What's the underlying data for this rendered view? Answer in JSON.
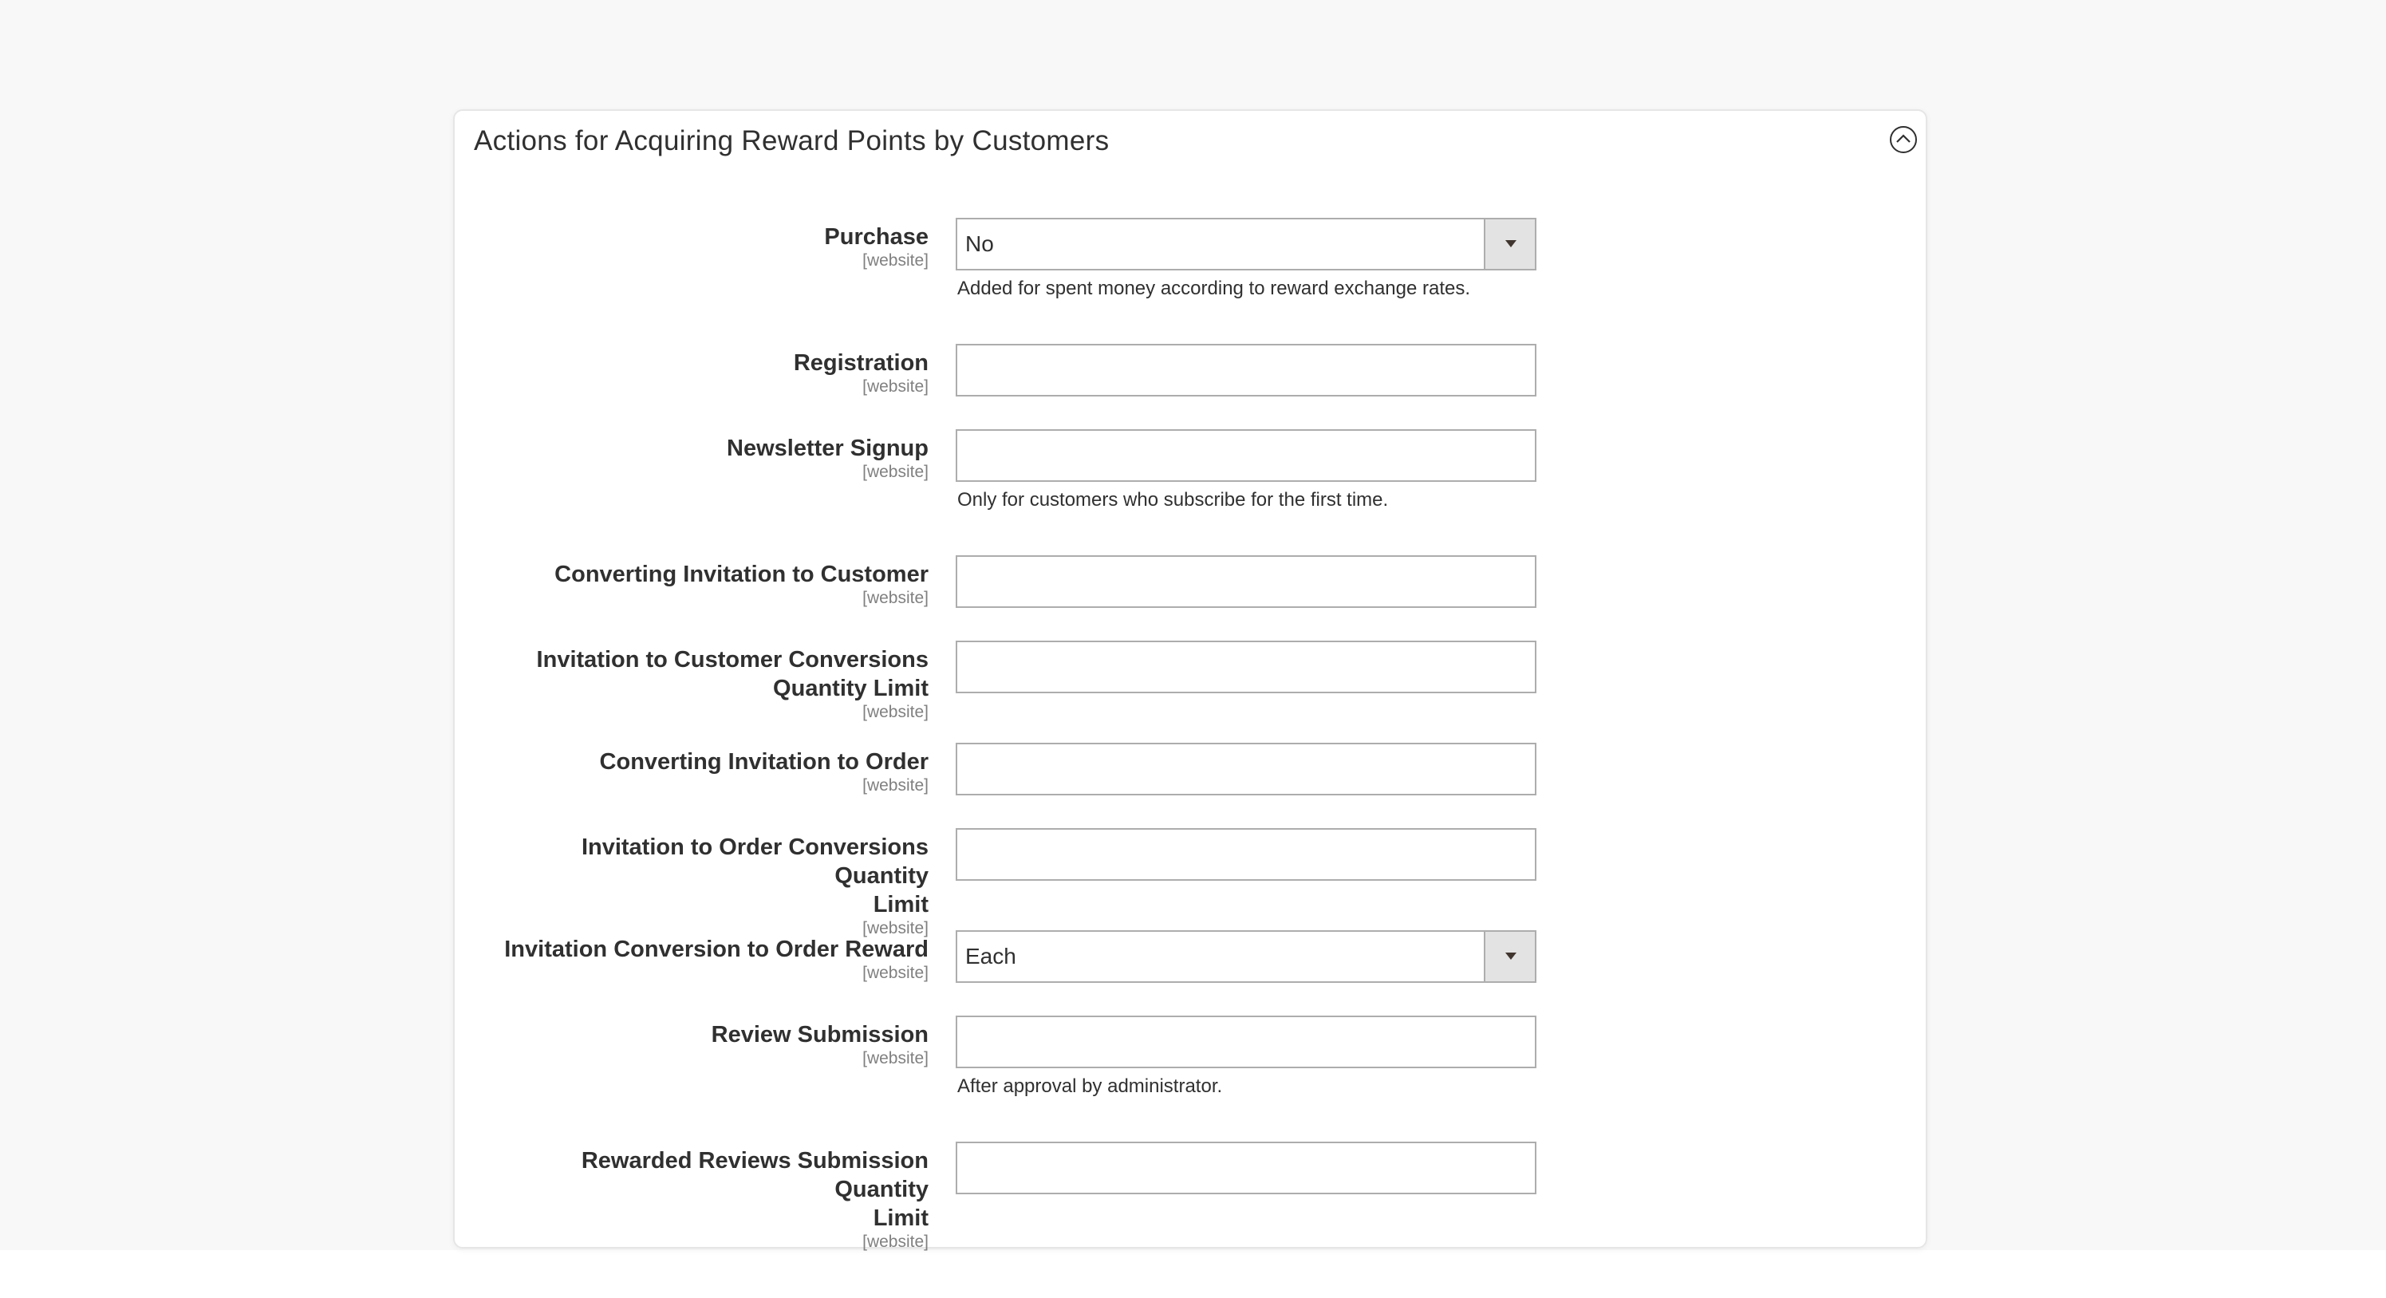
{
  "section": {
    "title": "Actions for Acquiring Reward Points by Customers"
  },
  "fields": [
    {
      "label_lines": [
        "Purchase"
      ],
      "scope": "[website]",
      "type": "select",
      "value": "No",
      "note": "Added for spent money according to reward exchange rates."
    },
    {
      "label_lines": [
        "Registration"
      ],
      "scope": "[website]",
      "type": "text",
      "value": ""
    },
    {
      "label_lines": [
        "Newsletter Signup"
      ],
      "scope": "[website]",
      "type": "text",
      "value": "",
      "note": "Only for customers who subscribe for the first time."
    },
    {
      "label_lines": [
        "Converting Invitation to Customer"
      ],
      "scope": "[website]",
      "type": "text",
      "value": ""
    },
    {
      "label_lines": [
        "Invitation to Customer Conversions",
        "Quantity Limit"
      ],
      "scope": "[website]",
      "type": "text",
      "value": ""
    },
    {
      "label_lines": [
        "Converting Invitation to Order"
      ],
      "scope": "[website]",
      "type": "text",
      "value": ""
    },
    {
      "label_lines": [
        "Invitation to Order Conversions Quantity",
        "Limit"
      ],
      "scope": "[website]",
      "type": "text",
      "value": ""
    },
    {
      "label_lines": [
        "Invitation Conversion to Order Reward"
      ],
      "scope": "[website]",
      "type": "select",
      "value": "Each"
    },
    {
      "label_lines": [
        "Review Submission"
      ],
      "scope": "[website]",
      "type": "text",
      "value": "",
      "note": "After approval by administrator."
    },
    {
      "label_lines": [
        "Rewarded Reviews Submission Quantity",
        "Limit"
      ],
      "scope": "[website]",
      "type": "text",
      "value": ""
    }
  ]
}
